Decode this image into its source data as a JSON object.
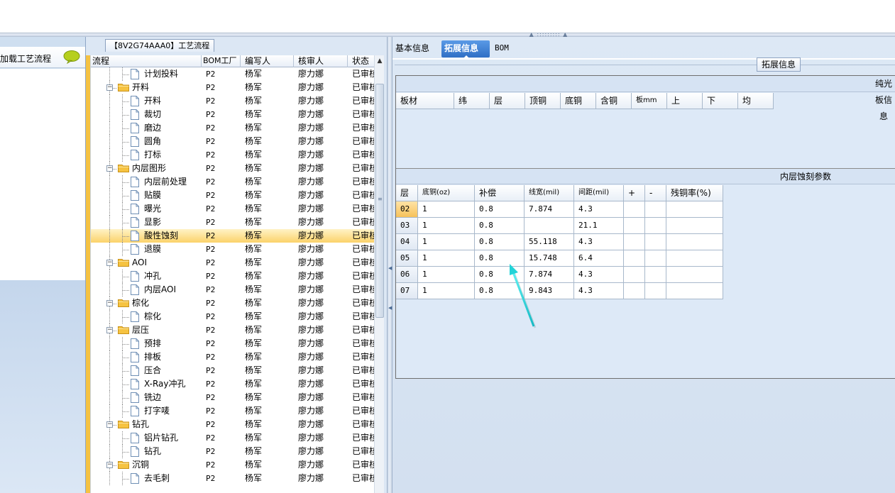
{
  "left_panel": {
    "header_label": "加载工艺流程"
  },
  "process_panel": {
    "title": "【8V2G74AAA0】工艺流程",
    "columns": [
      "流程",
      "BOM工厂",
      "编写人",
      "核审人",
      "状态"
    ],
    "rows": [
      {
        "level": 2,
        "type": "file",
        "name": "计划投料",
        "bom": "P2",
        "writer": "杨军",
        "reviewer": "廖力娜",
        "status": "已审核"
      },
      {
        "level": 1,
        "type": "folder",
        "name": "开料",
        "bom": "P2",
        "writer": "杨军",
        "reviewer": "廖力娜",
        "status": "已审核"
      },
      {
        "level": 2,
        "type": "file",
        "name": "开料",
        "bom": "P2",
        "writer": "杨军",
        "reviewer": "廖力娜",
        "status": "已审核"
      },
      {
        "level": 2,
        "type": "file",
        "name": "裁切",
        "bom": "P2",
        "writer": "杨军",
        "reviewer": "廖力娜",
        "status": "已审核"
      },
      {
        "level": 2,
        "type": "file",
        "name": "磨边",
        "bom": "P2",
        "writer": "杨军",
        "reviewer": "廖力娜",
        "status": "已审核"
      },
      {
        "level": 2,
        "type": "file",
        "name": "圆角",
        "bom": "P2",
        "writer": "杨军",
        "reviewer": "廖力娜",
        "status": "已审核"
      },
      {
        "level": 2,
        "type": "file",
        "name": "打标",
        "bom": "P2",
        "writer": "杨军",
        "reviewer": "廖力娜",
        "status": "已审核"
      },
      {
        "level": 1,
        "type": "folder",
        "name": "内层图形",
        "bom": "P2",
        "writer": "杨军",
        "reviewer": "廖力娜",
        "status": "已审核"
      },
      {
        "level": 2,
        "type": "file",
        "name": "内层前处理",
        "bom": "P2",
        "writer": "杨军",
        "reviewer": "廖力娜",
        "status": "已审核"
      },
      {
        "level": 2,
        "type": "file",
        "name": "贴膜",
        "bom": "P2",
        "writer": "杨军",
        "reviewer": "廖力娜",
        "status": "已审核"
      },
      {
        "level": 2,
        "type": "file",
        "name": "曝光",
        "bom": "P2",
        "writer": "杨军",
        "reviewer": "廖力娜",
        "status": "已审核"
      },
      {
        "level": 2,
        "type": "file",
        "name": "显影",
        "bom": "P2",
        "writer": "杨军",
        "reviewer": "廖力娜",
        "status": "已审核"
      },
      {
        "level": 2,
        "type": "file",
        "name": "酸性蚀刻",
        "bom": "P2",
        "writer": "杨军",
        "reviewer": "廖力娜",
        "status": "已审核",
        "selected": true
      },
      {
        "level": 2,
        "type": "file",
        "name": "退膜",
        "bom": "P2",
        "writer": "杨军",
        "reviewer": "廖力娜",
        "status": "已审核"
      },
      {
        "level": 1,
        "type": "folder",
        "name": "AOI",
        "bom": "P2",
        "writer": "杨军",
        "reviewer": "廖力娜",
        "status": "已审核"
      },
      {
        "level": 2,
        "type": "file",
        "name": "冲孔",
        "bom": "P2",
        "writer": "杨军",
        "reviewer": "廖力娜",
        "status": "已审核"
      },
      {
        "level": 2,
        "type": "file",
        "name": "内层AOI",
        "bom": "P2",
        "writer": "杨军",
        "reviewer": "廖力娜",
        "status": "已审核"
      },
      {
        "level": 1,
        "type": "folder",
        "name": "棕化",
        "bom": "P2",
        "writer": "杨军",
        "reviewer": "廖力娜",
        "status": "已审核"
      },
      {
        "level": 2,
        "type": "file",
        "name": "棕化",
        "bom": "P2",
        "writer": "杨军",
        "reviewer": "廖力娜",
        "status": "已审核"
      },
      {
        "level": 1,
        "type": "folder",
        "name": "层压",
        "bom": "P2",
        "writer": "杨军",
        "reviewer": "廖力娜",
        "status": "已审核"
      },
      {
        "level": 2,
        "type": "file",
        "name": "预排",
        "bom": "P2",
        "writer": "杨军",
        "reviewer": "廖力娜",
        "status": "已审核"
      },
      {
        "level": 2,
        "type": "file",
        "name": "排板",
        "bom": "P2",
        "writer": "杨军",
        "reviewer": "廖力娜",
        "status": "已审核"
      },
      {
        "level": 2,
        "type": "file",
        "name": "压合",
        "bom": "P2",
        "writer": "杨军",
        "reviewer": "廖力娜",
        "status": "已审核"
      },
      {
        "level": 2,
        "type": "file",
        "name": "X-Ray冲孔",
        "bom": "P2",
        "writer": "杨军",
        "reviewer": "廖力娜",
        "status": "已审核"
      },
      {
        "level": 2,
        "type": "file",
        "name": "铣边",
        "bom": "P2",
        "writer": "杨军",
        "reviewer": "廖力娜",
        "status": "已审核"
      },
      {
        "level": 2,
        "type": "file",
        "name": "打字唛",
        "bom": "P2",
        "writer": "杨军",
        "reviewer": "廖力娜",
        "status": "已审核"
      },
      {
        "level": 1,
        "type": "folder",
        "name": "钻孔",
        "bom": "P2",
        "writer": "杨军",
        "reviewer": "廖力娜",
        "status": "已审核"
      },
      {
        "level": 2,
        "type": "file",
        "name": "铝片钻孔",
        "bom": "P2",
        "writer": "杨军",
        "reviewer": "廖力娜",
        "status": "已审核"
      },
      {
        "level": 2,
        "type": "file",
        "name": "钻孔",
        "bom": "P2",
        "writer": "杨军",
        "reviewer": "廖力娜",
        "status": "已审核"
      },
      {
        "level": 1,
        "type": "folder",
        "name": "沉铜",
        "bom": "P2",
        "writer": "杨军",
        "reviewer": "廖力娜",
        "status": "已审核"
      },
      {
        "level": 2,
        "type": "file",
        "name": "去毛刺",
        "bom": "P2",
        "writer": "杨军",
        "reviewer": "廖力娜",
        "status": "已审核"
      }
    ]
  },
  "tabs": [
    "基本信息",
    "拓展信息",
    "BOM"
  ],
  "active_tab": "拓展信息",
  "group_label": "拓展信息",
  "light_board": {
    "title": "纯光板信息",
    "columns": [
      "板材",
      "纬",
      "层",
      "顶铜",
      "底铜",
      "含铜",
      "板mm",
      "上",
      "下",
      "均"
    ]
  },
  "inner_etch": {
    "title": "内层蚀刻参数",
    "columns": [
      "层",
      "底铜(oz)",
      "补偿",
      "线宽(mil)",
      "间距(mil)",
      "+",
      "-",
      "残铜率(%)"
    ],
    "rows": [
      {
        "layer": "02",
        "base_cu": "1",
        "comp": "0.8",
        "line_width": "7.874",
        "spacing": "4.3"
      },
      {
        "layer": "03",
        "base_cu": "1",
        "comp": "0.8",
        "line_width": "",
        "spacing": "21.1"
      },
      {
        "layer": "04",
        "base_cu": "1",
        "comp": "0.8",
        "line_width": "55.118",
        "spacing": "4.3"
      },
      {
        "layer": "05",
        "base_cu": "1",
        "comp": "0.8",
        "line_width": "15.748",
        "spacing": "6.4"
      },
      {
        "layer": "06",
        "base_cu": "1",
        "comp": "0.8",
        "line_width": "7.874",
        "spacing": "4.3"
      },
      {
        "layer": "07",
        "base_cu": "1",
        "comp": "0.8",
        "line_width": "9.843",
        "spacing": "4.3"
      }
    ]
  },
  "colors": {
    "accent_tab": "#2f6fc5",
    "selected_row": "#fbd26a",
    "arrow": "#22d3d8"
  }
}
